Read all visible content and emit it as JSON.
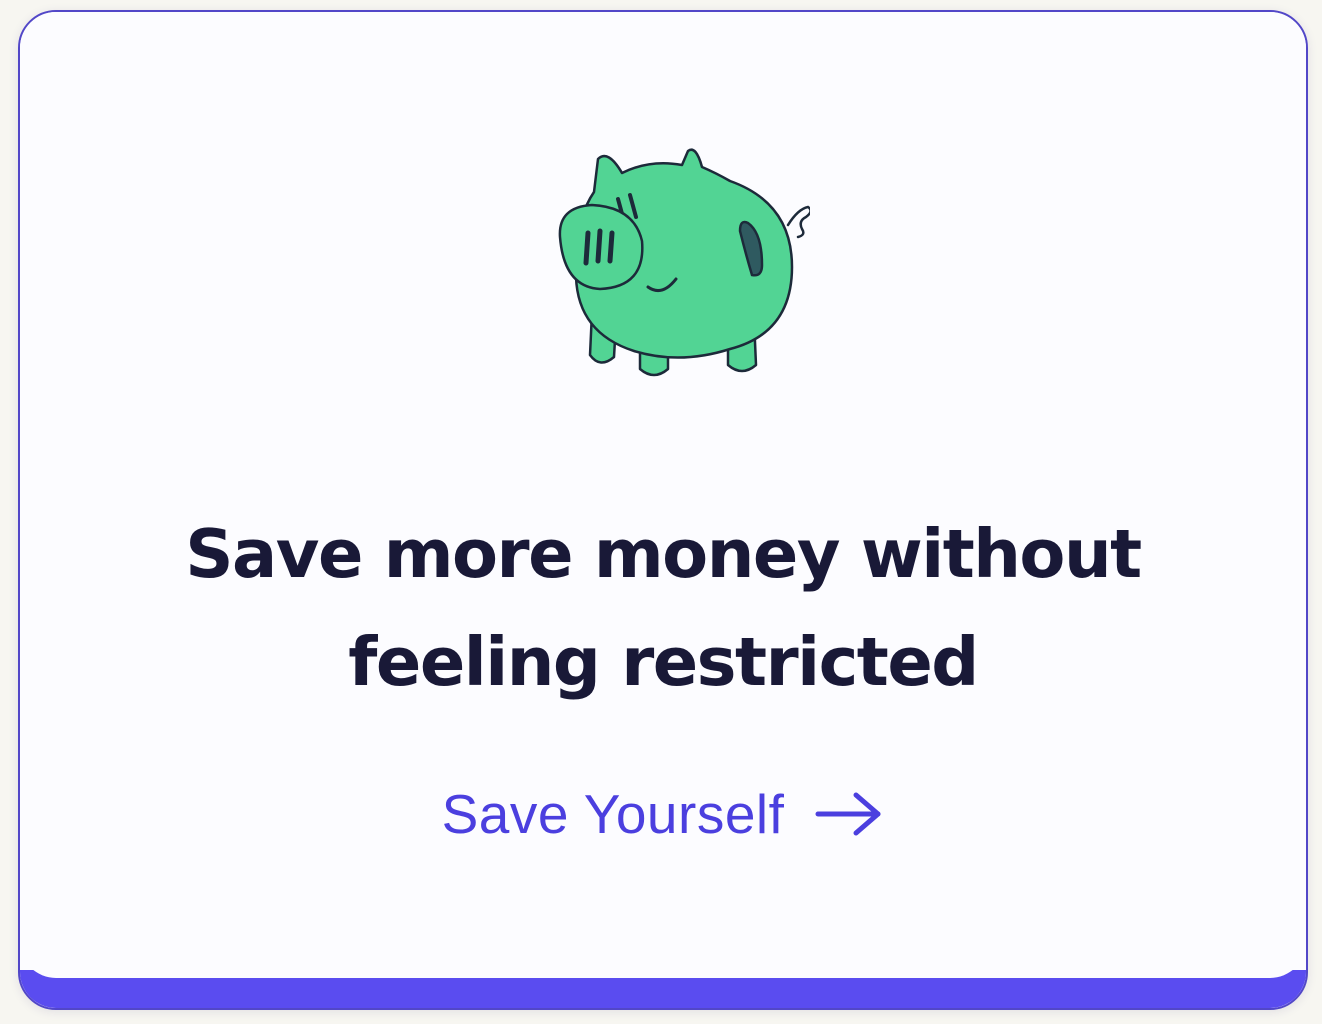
{
  "card": {
    "illustration": "piggy-bank-icon",
    "headline_line1": "Save more money without",
    "headline_line2": "feeling restricted",
    "cta_label": "Save Yourself",
    "cta_icon": "arrow-right-icon"
  },
  "colors": {
    "accent": "#4b3fdf",
    "bottom_bar": "#5a4cf0",
    "pig_green": "#52d494",
    "heading_text": "#191937",
    "card_background": "#fcfcff"
  }
}
